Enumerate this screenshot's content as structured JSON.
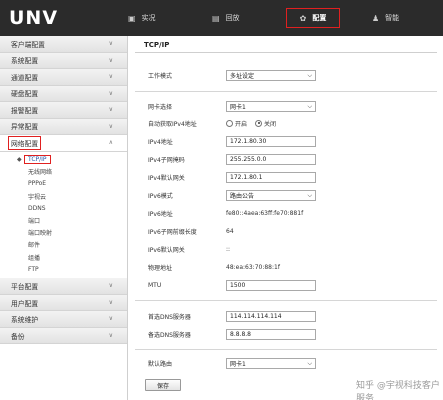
{
  "app": {
    "logo": "UNV"
  },
  "topnav": {
    "realtime": "实况",
    "playback": "回放",
    "config": "配置",
    "smart": "智能"
  },
  "sidebar": {
    "items_top": [
      "客户端配置",
      "系统配置",
      "通道配置",
      "硬盘配置",
      "报警配置",
      "异常配置"
    ],
    "network": "网络配置",
    "network_sub": [
      "TCP/IP",
      "无线网络",
      "PPPoE",
      "宇视云",
      "DDNS",
      "端口",
      "端口映射",
      "邮件",
      "组播",
      "FTP"
    ],
    "items_bottom": [
      "平台配置",
      "用户配置",
      "系统维护",
      "备份"
    ]
  },
  "content": {
    "title": "TCP/IP",
    "work_mode_label": "工作模式",
    "work_mode_value": "多址设定",
    "nic_select_label": "网卡选择",
    "nic_select_value": "网卡1",
    "dhcp_label": "自动获取IPv4地址",
    "dhcp_on": "开启",
    "dhcp_off": "关闭",
    "ipv4_addr_label": "IPv4地址",
    "ipv4_addr_value": "172.1.80.30",
    "ipv4_mask_label": "IPv4子网掩码",
    "ipv4_mask_value": "255.255.0.0",
    "ipv4_gw_label": "IPv4默认网关",
    "ipv4_gw_value": "172.1.80.1",
    "ipv6_mode_label": "IPv6模式",
    "ipv6_mode_value": "路由公告",
    "ipv6_addr_label": "IPv6地址",
    "ipv6_addr_value": "fe80::4aea:63ff:fe70:881f",
    "ipv6_prefix_label": "IPv6子网前缀长度",
    "ipv6_prefix_value": "64",
    "ipv6_gw_label": "IPv6默认网关",
    "ipv6_gw_value": "::",
    "mac_label": "物理地址",
    "mac_value": "48:ea:63:70:88:1f",
    "mtu_label": "MTU",
    "mtu_value": "1500",
    "dns1_label": "首选DNS服务器",
    "dns1_value": "114.114.114.114",
    "dns2_label": "备选DNS服务器",
    "dns2_value": "8.8.8.8",
    "default_route_label": "默认路由",
    "default_route_value": "网卡1",
    "save": "保存"
  },
  "watermark": "知乎 @宇视科技客户服务"
}
